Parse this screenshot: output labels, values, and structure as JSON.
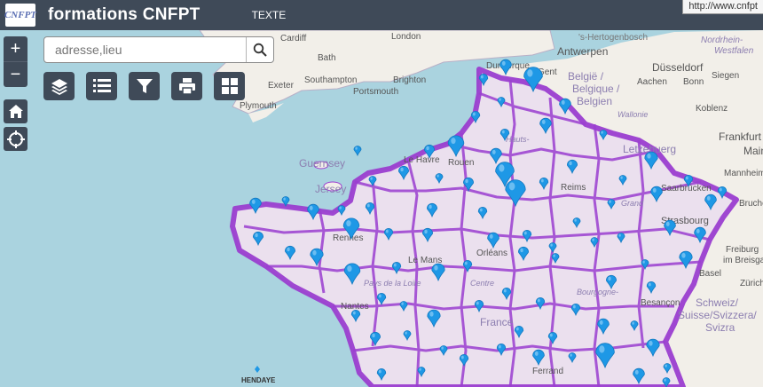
{
  "header": {
    "logo_text": "CNFPT",
    "title": "formations CNFPT",
    "menu_item": "TEXTE",
    "tooltip_url": "http://www.cnfpt"
  },
  "search": {
    "placeholder": "adresse,lieu"
  },
  "controls": {
    "zoom_in": "+",
    "zoom_out": "−"
  },
  "colors": {
    "header_bg": "#3f4a58",
    "sea": "#aad3df",
    "land": "#f2efe9",
    "region_fill": "#dfc2ea",
    "region_border": "#9b3fd0",
    "marker": "#1e98e6"
  },
  "icons": [
    "layers-icon",
    "list-icon",
    "filter-icon",
    "print-icon",
    "grid-icon",
    "home-icon",
    "locate-icon",
    "search-icon"
  ],
  "map_labels": {
    "cities": [
      "London",
      "Cardiff",
      "Bath",
      "Exeter",
      "Southampton",
      "Brighton",
      "Portsmouth",
      "Plymouth",
      "Dunkerque",
      "Gent",
      "Antwerpen",
      "Düsseldorf",
      "Aachen",
      "Bonn",
      "Siegen",
      "Koblenz",
      "Frankfurt",
      "Main",
      "Mannheim",
      "Saarbrücken",
      "Strasbourg",
      "Freiburg",
      "im Breisgau",
      "Basel",
      "Zürich",
      "Bruche",
      "Reims",
      "Rouen",
      "Le Havre",
      "Rennes",
      "Le Mans",
      "Nantes",
      "Besançon",
      "Orléans",
      "HENDAYE"
    ],
    "countries": [
      "België / Belgique / Belgien",
      "Letzebuerg",
      "France",
      "Schweiz/ Suisse/Svizzera/ Svizra",
      "Guernsey",
      "Jersey",
      "Nordrhein-Westfalen",
      "Wallonie",
      "Hauts-de-France",
      "Centre-Val de Loire",
      "Bourgogne-Franche-Comté",
      "Pays de la Loire",
      "Grand Est",
      "'s-Hertogenbosch",
      "Ferrand"
    ]
  }
}
